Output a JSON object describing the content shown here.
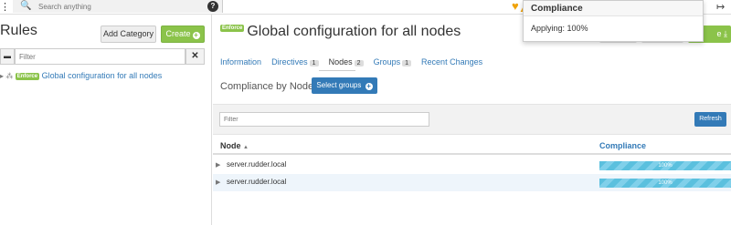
{
  "topbar": {
    "search_placeholder": "Search anything"
  },
  "tooltip": {
    "title": "Compliance",
    "body": "Applying: 100%"
  },
  "left": {
    "title": "Rules",
    "add_category_label": "Add Category",
    "create_label": "Create",
    "filter_placeholder": "Filter",
    "tree": [
      {
        "badge": "Enforce",
        "label": "Global configuration for all nodes"
      }
    ]
  },
  "rule": {
    "badge": "Enforce",
    "title": "Global configuration for all nodes",
    "save_label": "e",
    "tabs": [
      {
        "label": "Information",
        "count": null
      },
      {
        "label": "Directives",
        "count": "1"
      },
      {
        "label": "Nodes",
        "count": "2"
      },
      {
        "label": "Groups",
        "count": "1"
      },
      {
        "label": "Recent Changes",
        "count": null
      }
    ],
    "compliance_by_nodes_title": "Compliance by Nodes",
    "select_groups_label": "Select groups",
    "table_filter_placeholder": "Filter",
    "refresh_label": "Refresh",
    "columns": {
      "node": "Node",
      "compliance": "Compliance"
    },
    "rows": [
      {
        "node": "server.rudder.local",
        "compliance": "100%",
        "compliance_value": 100
      },
      {
        "node": "server.rudder.local",
        "compliance": "100%",
        "compliance_value": 100
      }
    ]
  }
}
